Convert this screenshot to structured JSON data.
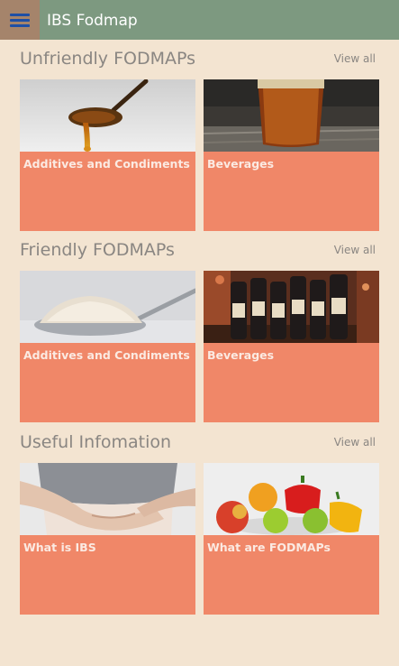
{
  "appbar": {
    "title": "IBS Fodmap",
    "menu_icon": "hamburger-menu-icon"
  },
  "sections": [
    {
      "title": "Unfriendly FODMAPs",
      "view_all": "View all",
      "cards": [
        {
          "label": "Additives and Condiments",
          "image": "honey-spoon"
        },
        {
          "label": "Beverages",
          "image": "beer-glass"
        }
      ]
    },
    {
      "title": "Friendly FODMAPs",
      "view_all": "View all",
      "cards": [
        {
          "label": "Additives and Condiments",
          "image": "sugar-spoon"
        },
        {
          "label": "Beverages",
          "image": "wine-bottles"
        }
      ]
    },
    {
      "title": "Useful Infomation",
      "view_all": "View all",
      "cards": [
        {
          "label": "What is IBS",
          "image": "stomach-pain"
        },
        {
          "label": "What are FODMAPs",
          "image": "fruits-vegetables"
        }
      ]
    }
  ],
  "colors": {
    "appbar": "#7d9980",
    "menu_button": "#a5846b",
    "background": "#f3e4d1",
    "card": "#f08768"
  }
}
